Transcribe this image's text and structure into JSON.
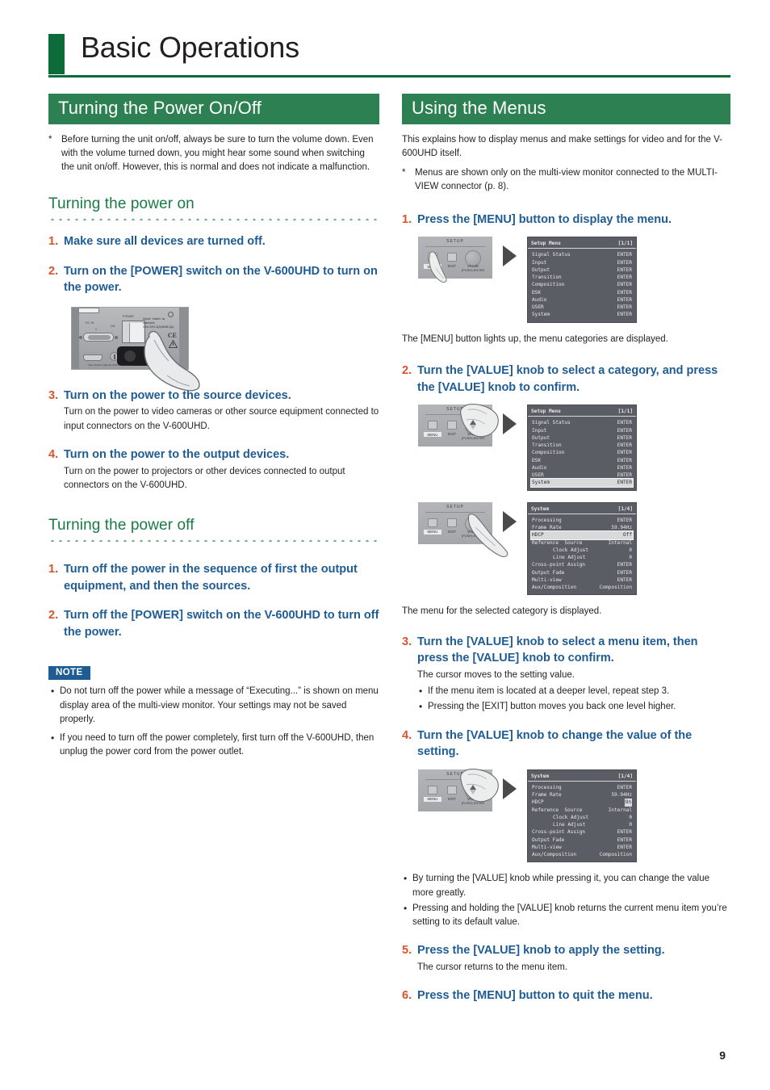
{
  "page": {
    "title": "Basic Operations",
    "number": "9"
  },
  "left": {
    "section_title": "Turning the Power On/Off",
    "intro_star": "*",
    "intro_text": "Before turning the unit on/off, always be sure to turn the volume down. Even with the volume turned down, you might hear some sound when switching the unit on/off. However, this is normal and does not indicate a malfunction.",
    "power_on": {
      "subhead": "Turning the power on",
      "steps": [
        {
          "num": "1.",
          "title": "Make sure all devices are turned off.",
          "sub": ""
        },
        {
          "num": "2.",
          "title": "Turn on the [POWER] switch on the V-600UHD to turn on the power.",
          "sub": ""
        },
        {
          "num": "3.",
          "title": "Turn on the power to the source devices.",
          "sub": "Turn on the power to video cameras or other source equipment connected to input connectors on the V-600UHD."
        },
        {
          "num": "4.",
          "title": "Turn on the power to the output devices.",
          "sub": "Turn on the power to projectors or other devices connected to output connectors on the V-600UHD."
        }
      ]
    },
    "rear_panel": {
      "dc_in_label": "DC IN",
      "dc_in_num": "1",
      "on_label": "ON",
      "power_label": "POWER",
      "cert_text": "Admin: <blank> as standards\nCAN ICES-3(A)/NMB-3(A)",
      "ce_mark": "CE",
      "bottom_text": "*See Owner's Manual before first use"
    },
    "power_off": {
      "subhead": "Turning the power off",
      "steps": [
        {
          "num": "1.",
          "title": "Turn off the power in the sequence of first the output equipment, and then the sources.",
          "sub": ""
        },
        {
          "num": "2.",
          "title": "Turn off the [POWER] switch on the V-600UHD to turn off the power.",
          "sub": ""
        }
      ]
    },
    "note": {
      "badge": "NOTE",
      "items": [
        "Do not turn off the power while a message of “Executing...” is shown on menu display area of the multi-view monitor. Your settings may not be saved properly.",
        "If you need to turn off the power completely, first turn off the V-600UHD, then unplug the power cord from the power outlet."
      ]
    }
  },
  "right": {
    "section_title": "Using the Menus",
    "intro_text": "This explains how to display menus and make settings for video and for the V-600UHD itself.",
    "intro_star": "*",
    "intro_star_text": "Menus are shown only on the multi-view monitor connected to the MULTI-VIEW connector (p. 8).",
    "steps": [
      {
        "num": "1.",
        "title": "Press the [MENU] button to display the menu."
      },
      {
        "num": "2.",
        "title": "Turn the [VALUE] knob to select a category, and press the [VALUE] knob to confirm."
      },
      {
        "num": "3.",
        "title": "Turn the [VALUE] knob to select a menu item, then press the [VALUE] knob to confirm."
      },
      {
        "num": "4.",
        "title": "Turn the [VALUE] knob to change the value of the setting."
      },
      {
        "num": "5.",
        "title": "Press the [VALUE] knob to apply the setting."
      },
      {
        "num": "6.",
        "title": "Press the [MENU] button to quit the menu."
      }
    ],
    "caption_1": "The [MENU] button lights up, the menu categories are displayed.",
    "caption_2": "The menu for the selected category is displayed.",
    "step3_sub": "The cursor moves to the setting value.",
    "step3_bullets": [
      "If the menu item is located at a deeper level, repeat step 3.",
      "Pressing the [EXIT] button moves you back one level higher."
    ],
    "step4_bullets": [
      "By turning the [VALUE] knob while pressing it, you can change the value more greatly.",
      "Pressing and holding the [VALUE] knob returns the current menu item you’re setting to its default value."
    ],
    "step5_sub": "The cursor returns to the menu item."
  },
  "panel": {
    "setup_label": "SETUP",
    "menu_label": "MENU",
    "exit_label": "EXIT",
    "value_label": "VALUE",
    "push_label": "(PUSH) ENTER"
  },
  "osd": {
    "setup_menu": {
      "title": "Setup Menu",
      "page": "[1/1]",
      "rows": [
        {
          "label": "Signal Status",
          "value": "ENTER",
          "selected": false
        },
        {
          "label": "Input",
          "value": "ENTER",
          "selected": false
        },
        {
          "label": "Output",
          "value": "ENTER",
          "selected": false
        },
        {
          "label": "Transition",
          "value": "ENTER",
          "selected": false
        },
        {
          "label": "Composition",
          "value": "ENTER",
          "selected": false
        },
        {
          "label": "DSK",
          "value": "ENTER",
          "selected": false
        },
        {
          "label": "Audio",
          "value": "ENTER",
          "selected": false
        },
        {
          "label": "USER",
          "value": "ENTER",
          "selected": false
        },
        {
          "label": "System",
          "value": "ENTER",
          "selected": false
        }
      ]
    },
    "setup_menu_selected": {
      "title": "Setup Menu",
      "page": "[1/1]",
      "selected_row": "System",
      "rows": [
        {
          "label": "Signal Status",
          "value": "ENTER",
          "selected": false
        },
        {
          "label": "Input",
          "value": "ENTER",
          "selected": false
        },
        {
          "label": "Output",
          "value": "ENTER",
          "selected": false
        },
        {
          "label": "Transition",
          "value": "ENTER",
          "selected": false
        },
        {
          "label": "Composition",
          "value": "ENTER",
          "selected": false
        },
        {
          "label": "DSK",
          "value": "ENTER",
          "selected": false
        },
        {
          "label": "Audio",
          "value": "ENTER",
          "selected": false
        },
        {
          "label": "USER",
          "value": "ENTER",
          "selected": false
        },
        {
          "label": "System",
          "value": "ENTER",
          "selected": true
        }
      ]
    },
    "system_menu_hdcp_off": {
      "title": "System",
      "page": "[1/4]",
      "rows": [
        {
          "label": "Processing",
          "value": "ENTER",
          "selected": false,
          "indent": false
        },
        {
          "label": "Frame Rate",
          "value": "59.94Hz",
          "selected": false,
          "indent": false
        },
        {
          "label": "HDCP",
          "value": "Off",
          "selected": true,
          "indent": false
        },
        {
          "label": "Reference  Source",
          "value": "Internal",
          "selected": false,
          "indent": false
        },
        {
          "label": "Clock Adjust",
          "value": "0",
          "selected": false,
          "indent": true
        },
        {
          "label": "Line Adjust",
          "value": "0",
          "selected": false,
          "indent": true
        },
        {
          "label": "Cross-point Assign",
          "value": "ENTER",
          "selected": false,
          "indent": false
        },
        {
          "label": "Output Fade",
          "value": "ENTER",
          "selected": false,
          "indent": false
        },
        {
          "label": "Multi-view",
          "value": "ENTER",
          "selected": false,
          "indent": false
        },
        {
          "label": "Aux/Composition",
          "value": "Composition",
          "selected": false,
          "indent": false
        }
      ]
    },
    "system_menu_hdcp_on": {
      "title": "System",
      "page": "[1/4]",
      "rows": [
        {
          "label": "Processing",
          "value": "ENTER",
          "value_selected": false,
          "indent": false
        },
        {
          "label": "Frame Rate",
          "value": "59.94Hz",
          "value_selected": false,
          "indent": false
        },
        {
          "label": "HDCP",
          "value": "On",
          "value_selected": true,
          "indent": false
        },
        {
          "label": "Reference  Source",
          "value": "Internal",
          "value_selected": false,
          "indent": false
        },
        {
          "label": "Clock Adjust",
          "value": "0",
          "value_selected": false,
          "indent": true
        },
        {
          "label": "Line Adjust",
          "value": "0",
          "value_selected": false,
          "indent": true
        },
        {
          "label": "Cross-point Assign",
          "value": "ENTER",
          "value_selected": false,
          "indent": false
        },
        {
          "label": "Output Fade",
          "value": "ENTER",
          "value_selected": false,
          "indent": false
        },
        {
          "label": "Multi-view",
          "value": "ENTER",
          "value_selected": false,
          "indent": false
        },
        {
          "label": "Aux/Composition",
          "value": "Composition",
          "value_selected": false,
          "indent": false
        }
      ]
    }
  },
  "colors": {
    "green_bar": "#2d8051",
    "green_dark": "#0c6b38",
    "subhead_green": "#1a7a43",
    "step_num": "#d9532c",
    "step_title": "#1f5c93",
    "note_badge": "#1f5c93"
  }
}
